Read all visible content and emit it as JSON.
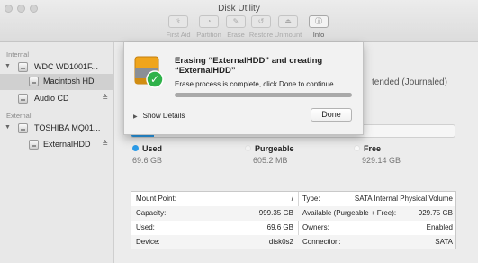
{
  "window": {
    "title": "Disk Utility"
  },
  "toolbar": {
    "buttons": [
      {
        "label": "First Aid",
        "icon": "stethoscope-icon",
        "glyph": "⚕",
        "active": false
      },
      {
        "label": "Partition",
        "icon": "partition-icon",
        "glyph": "◔",
        "active": false
      },
      {
        "label": "Erase",
        "icon": "erase-icon",
        "glyph": "✎",
        "active": false
      },
      {
        "label": "Restore",
        "icon": "restore-icon",
        "glyph": "↺",
        "active": false
      },
      {
        "label": "Unmount",
        "icon": "unmount-icon",
        "glyph": "⏏",
        "active": false
      },
      {
        "label": "Info",
        "icon": "info-icon",
        "glyph": "ⓘ",
        "active": true
      }
    ]
  },
  "sidebar": {
    "internal_label": "Internal",
    "external_label": "External",
    "items": [
      {
        "label": "WDC WD1001F...",
        "kind": "disk"
      },
      {
        "label": "Macintosh HD",
        "kind": "volume",
        "selected": true
      },
      {
        "label": "Audio CD",
        "kind": "disk",
        "eject": "≜"
      },
      {
        "label": "TOSHIBA MQ01...",
        "kind": "disk"
      },
      {
        "label": "ExternalHDD",
        "kind": "volume",
        "eject": "≜"
      }
    ],
    "disclosure_glyph": "▼"
  },
  "main": {
    "volume_format_partial": "tended (Journaled)",
    "usage": {
      "used_fraction": 0.07,
      "colors": {
        "used": "#2a9be8",
        "purgeable": "#f3f3f3",
        "free": "#fafafa"
      },
      "legend": [
        {
          "name": "Used",
          "value": "69.6 GB"
        },
        {
          "name": "Purgeable",
          "value": "605.2 MB"
        },
        {
          "name": "Free",
          "value": "929.14 GB"
        }
      ]
    },
    "info": [
      {
        "left_label": "Mount Point:",
        "left_value": "/",
        "right_label": "Type:",
        "right_value": "SATA Internal Physical Volume"
      },
      {
        "left_label": "Capacity:",
        "left_value": "999.35 GB",
        "right_label": "Available (Purgeable + Free):",
        "right_value": "929.75 GB"
      },
      {
        "left_label": "Used:",
        "left_value": "69.6 GB",
        "right_label": "Owners:",
        "right_value": "Enabled"
      },
      {
        "left_label": "Device:",
        "left_value": "disk0s2",
        "right_label": "Connection:",
        "right_value": "SATA"
      }
    ]
  },
  "sheet": {
    "title": "Erasing “ExternalHDD” and creating “ExternalHDD”",
    "message": "Erase process is complete, click Done to continue.",
    "progress": 1.0,
    "show_details_label": "Show Details",
    "disclosure_glyph": "▶",
    "done_label": "Done",
    "check_glyph": "✓"
  }
}
